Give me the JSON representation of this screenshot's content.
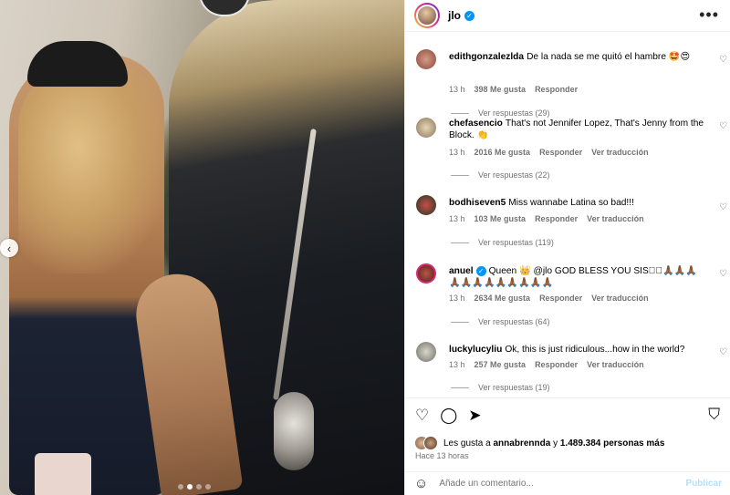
{
  "post": {
    "username": "jlo",
    "verified": true,
    "more_label": "•••"
  },
  "media": {
    "prev_label": "‹",
    "dots": 4,
    "active_dot": 1
  },
  "comments": [
    {
      "username": "edithgonzalezlda",
      "text": "De la nada se me quitó el hambre 🤩😍",
      "time": "13 h",
      "likes": "398 Me gusta",
      "reply": "Responder",
      "translate": "",
      "replies": "Ver respuestas (29)",
      "avatar_color": "#8b4a3a"
    },
    {
      "username": "chefasencio",
      "text": "That's not Jennifer Lopez, That's Jenny from the Block. 👏",
      "time": "13 h",
      "likes": "2016 Me gusta",
      "reply": "Responder",
      "translate": "Ver traducción",
      "replies": "Ver respuestas (22)",
      "avatar_color": "#c8b28f"
    },
    {
      "username": "bodhiseven5",
      "text": "Miss wannabe Latina so bad!!!",
      "time": "13 h",
      "likes": "103 Me gusta",
      "reply": "Responder",
      "translate": "Ver traducción",
      "replies": "Ver respuestas (119)",
      "avatar_color": "#3c5a3a"
    },
    {
      "username": "anuel",
      "verified": true,
      "text": "Queen 👑 @jlo GOD BLESS YOU SIS🅿🏾🙏🏾🙏🏾🙏🏾🙏🏾🙏🏾🙏🏾🙏🏾🙏🏾🙏🏾🙏🏾🙏🏾🙏🏾",
      "time": "13 h",
      "likes": "2634 Me gusta",
      "reply": "Responder",
      "translate": "Ver traducción",
      "replies": "Ver respuestas (64)",
      "avatar_color": "#7b3b2a"
    },
    {
      "username": "luckylucyliu",
      "text": "Ok, this is just ridiculous...how in the world?",
      "time": "13 h",
      "likes": "257 Me gusta",
      "reply": "Responder",
      "translate": "Ver traducción",
      "replies": "Ver respuestas (19)",
      "avatar_color": "#9e9e94"
    }
  ],
  "likes": {
    "prefix": "Les gusta a",
    "user": "annabrennda",
    "conj": "y",
    "count": "1.489.384 personas más"
  },
  "time_ago": "Hace 13 horas",
  "add_comment": {
    "placeholder": "Añade un comentario...",
    "post_label": "Publicar"
  }
}
